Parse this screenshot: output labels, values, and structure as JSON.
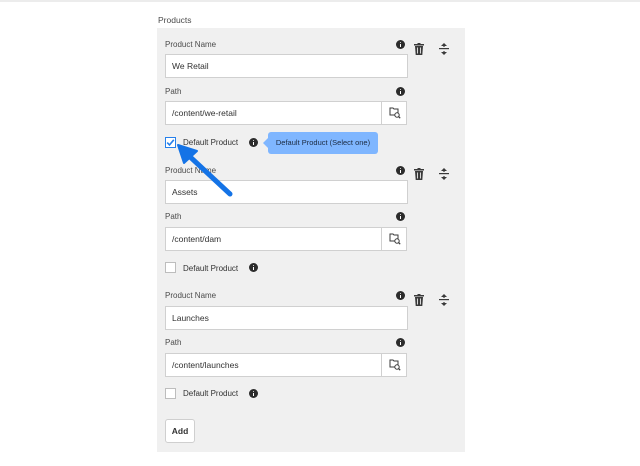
{
  "section_label": "Products",
  "items": [
    {
      "product_name_label": "Product Name",
      "product_name_value": "We Retail",
      "path_label": "Path",
      "path_value": "/content/we-retail",
      "default_label": "Default Product",
      "default_checked": true
    },
    {
      "product_name_label": "Product Name",
      "product_name_value": "Assets",
      "path_label": "Path",
      "path_value": "/content/dam",
      "default_label": "Default Product",
      "default_checked": false
    },
    {
      "product_name_label": "Product Name",
      "product_name_value": "Launches",
      "path_label": "Path",
      "path_value": "/content/launches",
      "default_label": "Default Product",
      "default_checked": false
    }
  ],
  "tooltip": "Default Product (Select one)",
  "add_label": "Add",
  "colors": {
    "accent": "#2680eb",
    "tooltip_bg": "#7fb6ff",
    "panel_bg": "#f0f0f0",
    "arrow": "#1473e6"
  },
  "icons": {
    "info": "info-icon",
    "delete": "trash-icon",
    "reorder": "drag-handle-icon",
    "browse": "folder-search-icon",
    "check": "checkmark-icon"
  }
}
